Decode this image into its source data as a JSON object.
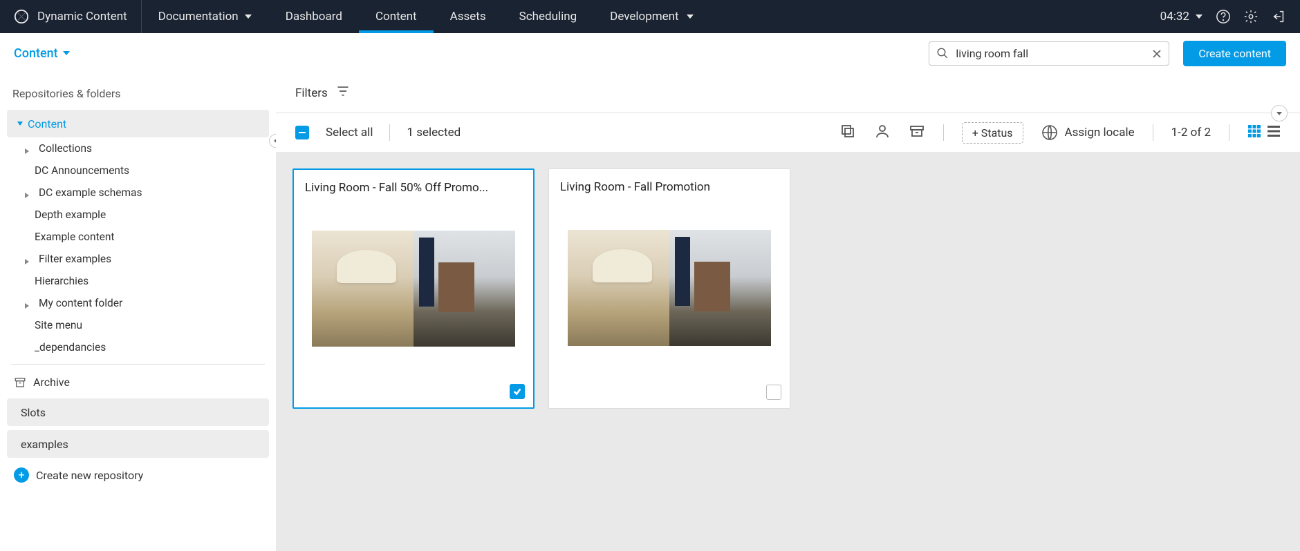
{
  "brand": "Dynamic Content",
  "topnav": {
    "documentation": "Documentation",
    "tabs": [
      "Dashboard",
      "Content",
      "Assets",
      "Scheduling",
      "Development"
    ],
    "active": "Content",
    "time": "04:32"
  },
  "subbar": {
    "content_label": "Content",
    "search_value": "living room fall",
    "create_label": "Create content"
  },
  "sidebar": {
    "heading": "Repositories & folders",
    "root": "Content",
    "children": [
      {
        "label": "Collections",
        "expandable": true
      },
      {
        "label": "DC Announcements",
        "expandable": false
      },
      {
        "label": "DC example schemas",
        "expandable": true
      },
      {
        "label": "Depth example",
        "expandable": false
      },
      {
        "label": "Example content",
        "expandable": false
      },
      {
        "label": "Filter examples",
        "expandable": true
      },
      {
        "label": "Hierarchies",
        "expandable": false
      },
      {
        "label": "My content folder",
        "expandable": true
      },
      {
        "label": "Site menu",
        "expandable": false
      },
      {
        "label": "_dependancies",
        "expandable": false
      }
    ],
    "archive": "Archive",
    "sections": [
      "Slots",
      "examples"
    ],
    "create_repo": "Create new repository"
  },
  "filters": {
    "label": "Filters"
  },
  "toolbar": {
    "select_all": "Select all",
    "selected": "1 selected",
    "status": "+ Status",
    "assign_locale": "Assign locale",
    "pager": "1-2 of 2"
  },
  "cards": [
    {
      "title": "Living Room - Fall 50% Off Promo...",
      "selected": true
    },
    {
      "title": "Living Room - Fall Promotion",
      "selected": false
    }
  ]
}
